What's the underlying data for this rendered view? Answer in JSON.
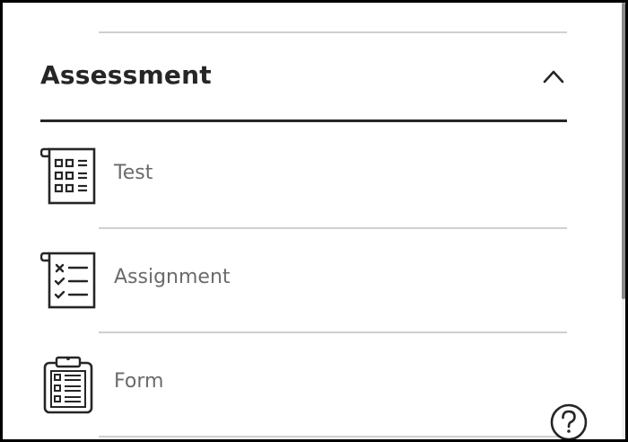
{
  "section": {
    "title": "Assessment",
    "expanded": true,
    "toggle_icon": "chevron-up-icon"
  },
  "items": [
    {
      "label": "Test",
      "icon": "test-icon"
    },
    {
      "label": "Assignment",
      "icon": "assignment-icon"
    },
    {
      "label": "Form",
      "icon": "form-icon"
    }
  ],
  "help": {
    "icon": "help-icon"
  },
  "colors": {
    "text_dark": "#262626",
    "text_muted": "#6b6b6b",
    "divider": "#cfcfcf",
    "frame": "#000000"
  }
}
